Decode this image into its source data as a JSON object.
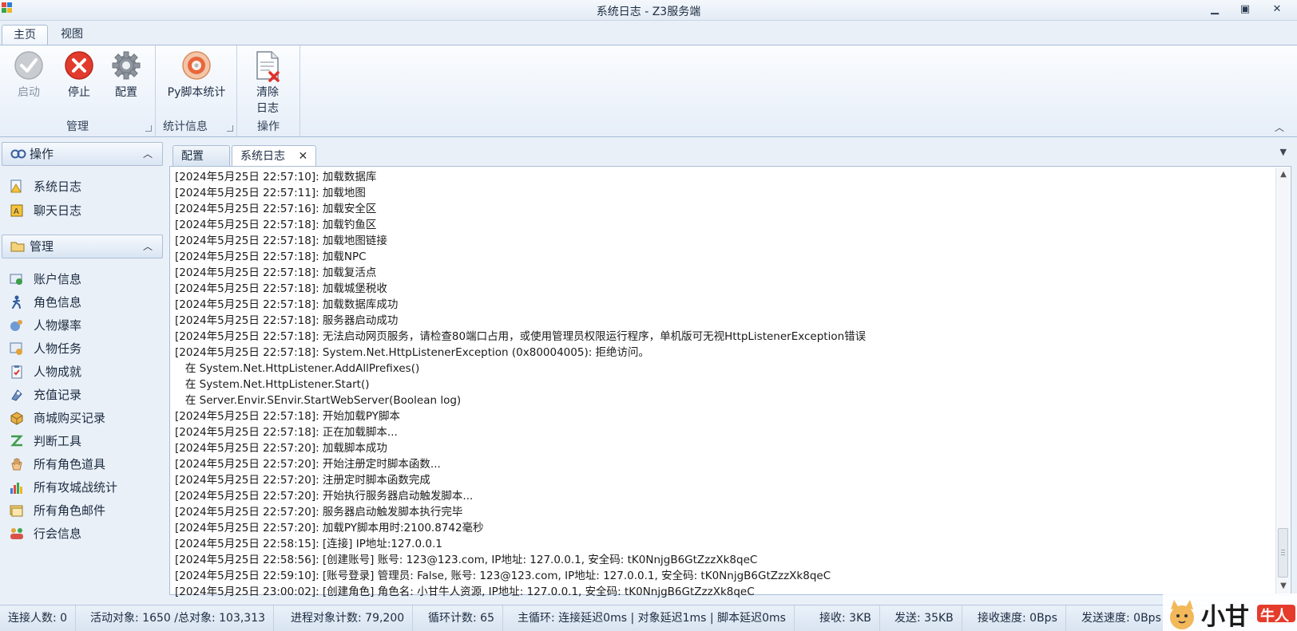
{
  "window": {
    "title": "系统日志 - Z3服务端"
  },
  "ribbon_tabs": [
    {
      "label": "主页",
      "active": true
    },
    {
      "label": "视图",
      "active": false
    }
  ],
  "ribbon": {
    "groups": {
      "manage": {
        "label": "管理"
      },
      "stats": {
        "label": "统计信息"
      },
      "ops": {
        "label": "操作"
      }
    },
    "buttons": {
      "start": "启动",
      "stop": "停止",
      "config": "配置",
      "py_stats": "Py脚本统计",
      "clear_log_1": "清除",
      "clear_log_2": "日志"
    }
  },
  "nav": {
    "ops_header": "操作",
    "ops_items": [
      "系统日志",
      "聊天日志"
    ],
    "manage_header": "管理",
    "manage_items": [
      "账户信息",
      "角色信息",
      "人物爆率",
      "人物任务",
      "人物成就",
      "充值记录",
      "商城购买记录",
      "判断工具",
      "所有角色道具",
      "所有攻城战统计",
      "所有角色邮件",
      "行会信息"
    ]
  },
  "doc_tabs": [
    {
      "label": "配置",
      "active": false
    },
    {
      "label": "系统日志",
      "active": true
    }
  ],
  "log_lines": [
    "[2024年5月25日 22:57:10]: 加载数据库",
    "[2024年5月25日 22:57:11]: 加载地图",
    "[2024年5月25日 22:57:16]: 加载安全区",
    "[2024年5月25日 22:57:18]: 加载钓鱼区",
    "[2024年5月25日 22:57:18]: 加载地图链接",
    "[2024年5月25日 22:57:18]: 加载NPC",
    "[2024年5月25日 22:57:18]: 加载复活点",
    "[2024年5月25日 22:57:18]: 加载城堡税收",
    "[2024年5月25日 22:57:18]: 加载数据库成功",
    "[2024年5月25日 22:57:18]: 服务器启动成功",
    "[2024年5月25日 22:57:18]: 无法启动网页服务，请检查80端口占用，或使用管理员权限运行程序，单机版可无视HttpListenerException错误",
    "[2024年5月25日 22:57:18]: System.Net.HttpListenerException (0x80004005): 拒绝访问。",
    "   在 System.Net.HttpListener.AddAllPrefixes()",
    "   在 System.Net.HttpListener.Start()",
    "   在 Server.Envir.SEnvir.StartWebServer(Boolean log)",
    "[2024年5月25日 22:57:18]: 开始加载PY脚本",
    "[2024年5月25日 22:57:18]: 正在加载脚本...",
    "[2024年5月25日 22:57:20]: 加载脚本成功",
    "[2024年5月25日 22:57:20]: 开始注册定时脚本函数...",
    "[2024年5月25日 22:57:20]: 注册定时脚本函数完成",
    "[2024年5月25日 22:57:20]: 开始执行服务器启动触发脚本...",
    "[2024年5月25日 22:57:20]: 服务器启动触发脚本执行完毕",
    "[2024年5月25日 22:57:20]: 加载PY脚本用时:2100.8742毫秒",
    "[2024年5月25日 22:58:15]: [连接] IP地址:127.0.0.1",
    "[2024年5月25日 22:58:56]: [创建账号] 账号: 123@123.com, IP地址: 127.0.0.1, 安全码: tK0NnjgB6GtZzzXk8qeC",
    "[2024年5月25日 22:59:10]: [账号登录] 管理员: False, 账号: 123@123.com, IP地址: 127.0.0.1, 安全码: tK0NnjgB6GtZzzXk8qeC",
    "[2024年5月25日 23:00:02]: [创建角色] 角色名: 小甘牛人资源, IP地址: 127.0.0.1, 安全码: tK0NnjgB6GtZzzXk8qeC"
  ],
  "status": {
    "connections": "连接人数: 0",
    "active_objects": "活动对象: 1650 /总对象: 103,313",
    "process_objects": "进程对象计数: 79,200",
    "loop_count": "循环计数: 65",
    "main_loop": "主循环: 连接延迟0ms | 对象延迟1ms | 脚本延迟0ms",
    "received": "接收: 3KB",
    "sent": "发送: 35KB",
    "recv_speed": "接收速度: 0Bps",
    "send_speed": "发送速度: 0Bps"
  },
  "watermark": {
    "text": "小甘",
    "badge": "牛人"
  }
}
